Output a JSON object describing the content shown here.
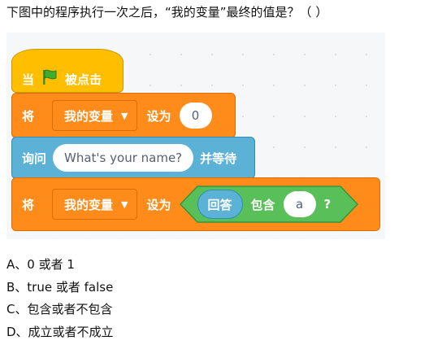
{
  "question": "下图中的程序执行一次之后，“我的变量”最终的值是？（ ）",
  "blocks": {
    "when_flag_prefix": "当",
    "when_flag_suffix": "被点击",
    "set1_label": "将",
    "set1_variable": "我的变量",
    "set1_to": "设为",
    "set1_value": "0",
    "ask_label": "询问",
    "ask_value": "What's your name?",
    "ask_wait": "并等待",
    "set2_label": "将",
    "set2_variable": "我的变量",
    "set2_to": "设为",
    "answer_label": "回答",
    "contains_label": "包含",
    "contains_value": "a",
    "question_mark": "?"
  },
  "options": [
    "A、0 或者 1",
    "B、true 或者 false",
    "C、包含或者不包含",
    "D、成立或者不成立"
  ],
  "colors": {
    "events": "#ffbf00",
    "variables": "#ff8c1a",
    "sensing": "#5cb1d6",
    "operators": "#59c059",
    "flag": "#3fae2a"
  },
  "icons": {
    "green_flag": "flag-icon",
    "dropdown": "chevron-down-icon"
  }
}
